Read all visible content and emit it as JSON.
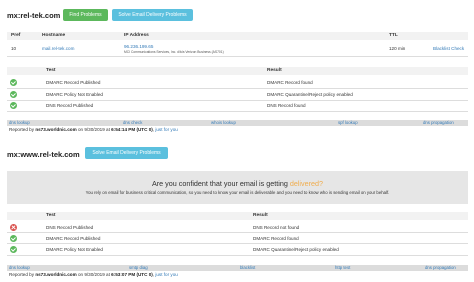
{
  "section1": {
    "title": "mx:rel-tek.com",
    "find_problems_label": "Find Problems",
    "solve_label": "Solve Email Delivery Problems",
    "headers": {
      "pref": "Pref",
      "hostname": "Hostname",
      "ip": "IP Address",
      "ttl": "TTL"
    },
    "mx_row": {
      "pref": "10",
      "hostname": "mail.rel-tek.com",
      "ip": "96.236.199.65",
      "ip_org": "MCI Communications Services, Inc. d/b/a Verizon Business (AS701)",
      "ttl": "120 min",
      "action": "Blacklist Check"
    },
    "test_headers": {
      "test": "Test",
      "result": "Result"
    },
    "tests": [
      {
        "status": "ok",
        "test": "DMARC Record Published",
        "result": "DMARC Record found"
      },
      {
        "status": "ok",
        "test": "DMARC Policy Not Enabled",
        "result": "DMARC Quarantine/Reject policy enabled"
      },
      {
        "status": "ok",
        "test": "DNS Record Published",
        "result": "DNS Record found"
      }
    ],
    "tools": [
      "dns lookup",
      "dns check",
      "whois lookup",
      "spf lookup",
      "dns propagation"
    ],
    "report": {
      "prefix": "Reported by",
      "server": "ns73.worldnic.com",
      "on": "on 9/30/2019 at",
      "time": "6:54:14 PM (UTC 0)",
      "dash": ",",
      "link": "just for you"
    }
  },
  "section2": {
    "title": "mx:www.rel-tek.com",
    "solve_label": "Solve Email Delivery Problems",
    "confidence": {
      "question": "Are you confident that your email is getting",
      "highlight": "delivered?",
      "sub": "You rely on email for business critical communication, so you need to know your email is deliverable and you need to know who is sending email on your behalf."
    },
    "test_headers": {
      "test": "Test",
      "result": "Result"
    },
    "tests": [
      {
        "status": "error",
        "test": "DNS Record Published",
        "result": "DNS Record not found"
      },
      {
        "status": "ok",
        "test": "DMARC Record Published",
        "result": "DMARC Record found"
      },
      {
        "status": "ok",
        "test": "DMARC Policy Not Enabled",
        "result": "DMARC Quarantine/Reject policy enabled"
      }
    ],
    "tools": [
      "dns lookup",
      "smtp diag",
      "blacklist",
      "http test",
      "dns propagation"
    ],
    "report": {
      "prefix": "Reported by",
      "server": "ns73.worldnic.com",
      "on": "on 9/30/2019 at",
      "time": "6:53:07 PM (UTC 0)",
      "dash": ",",
      "link": "just for you"
    }
  },
  "colors": {
    "green": "#5cb85c",
    "blue": "#5bc0de",
    "red": "#d9534f",
    "link": "#337ab7",
    "highlight": "#f0ad4e"
  }
}
